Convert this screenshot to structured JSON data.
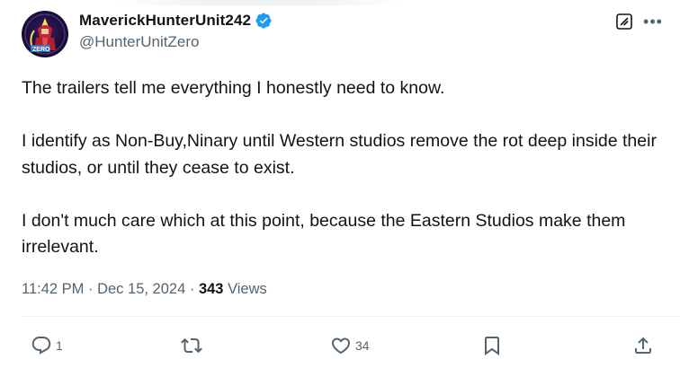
{
  "author": {
    "display_name": "MaverickHunterUnit242",
    "handle": "@HunterUnitZero",
    "avatar_icon": "zero-character-avatar",
    "verified_icon": "verified-badge-icon"
  },
  "tweet": {
    "paragraphs": [
      "The trailers tell me everything I honestly need to know.",
      "I identify as Non-Buy,Ninary until Western studios remove the rot deep inside their studios, or until they cease to exist.",
      "I don't much care which at this point, because the Eastern Studios make them irrelevant."
    ]
  },
  "meta": {
    "time": "11:42 PM",
    "separator": "·",
    "date": "Dec 15, 2024",
    "views_count": "343",
    "views_label": "Views"
  },
  "actions": {
    "reply_count": "1",
    "retweet_count": "",
    "like_count": "34"
  },
  "colors": {
    "accent": "#1d9bf0",
    "text_primary": "#0f1419",
    "text_secondary": "#536471",
    "divider": "#eff3f4"
  }
}
